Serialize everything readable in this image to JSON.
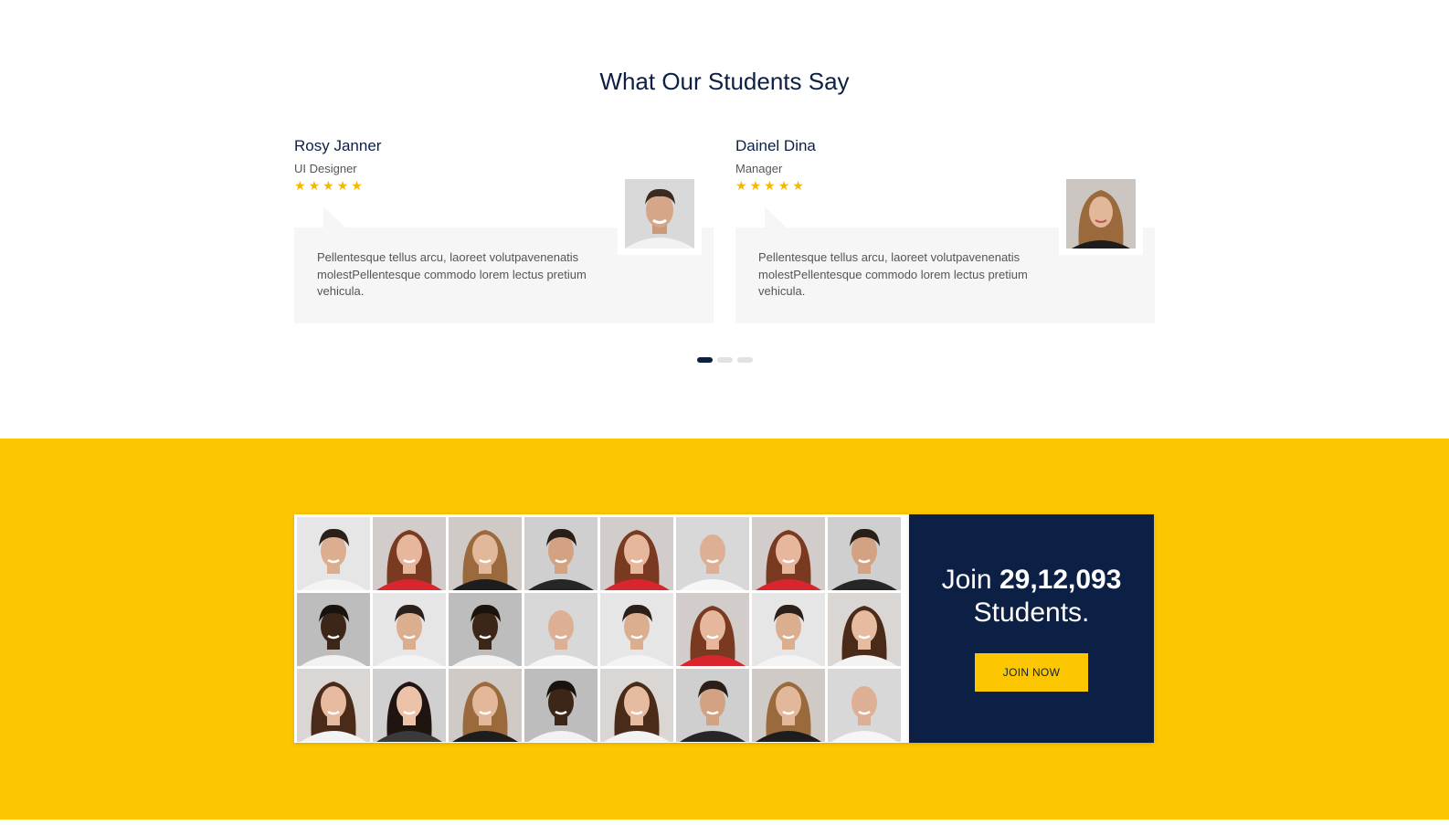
{
  "testimonials": {
    "title": "What Our Students Say",
    "cards": [
      {
        "name": "Rosy Janner",
        "role": "UI Designer",
        "rating": 5,
        "quote": "Pellentesque tellus arcu, laoreet volutpavenenatis molestPellentesque commodo lorem lectus pretium vehicula.",
        "photo": "man-portrait"
      },
      {
        "name": "Dainel Dina",
        "role": "Manager",
        "rating": 5,
        "quote": "Pellentesque tellus arcu, laoreet volutpavenenatis molestPellentesque commodo lorem lectus pretium vehicula.",
        "photo": "woman-portrait"
      }
    ],
    "pagination": {
      "pages": 3,
      "active": 1
    }
  },
  "join": {
    "prefix": "Join",
    "count": "29,12,093",
    "suffix": "Students.",
    "button_label": "JOIN NOW"
  },
  "mosaic": {
    "tiles": [
      "man-white-shirt",
      "woman-red-top",
      "woman-curly-black-top",
      "man-beard-black-shirt",
      "woman-red-top",
      "man-bald-white-shirt",
      "woman-red-top",
      "man-beard-black-shirt",
      "man-dark-smiling",
      "man-white-shirt",
      "man-dark-smiling",
      "man-bald-white-shirt",
      "man-white-shirt",
      "woman-red-top",
      "man-white-shirt",
      "woman-white-top",
      "woman-white-top",
      "woman-dark-hair",
      "woman-curly-black-top",
      "man-dark-smiling",
      "woman-white-top",
      "man-beard-black-shirt",
      "woman-curly-black-top",
      "man-bald-white-shirt"
    ]
  },
  "colors": {
    "navy": "#0c1f45",
    "yellow": "#fcc600",
    "star": "#f5b800",
    "bubble": "#f6f6f6"
  }
}
